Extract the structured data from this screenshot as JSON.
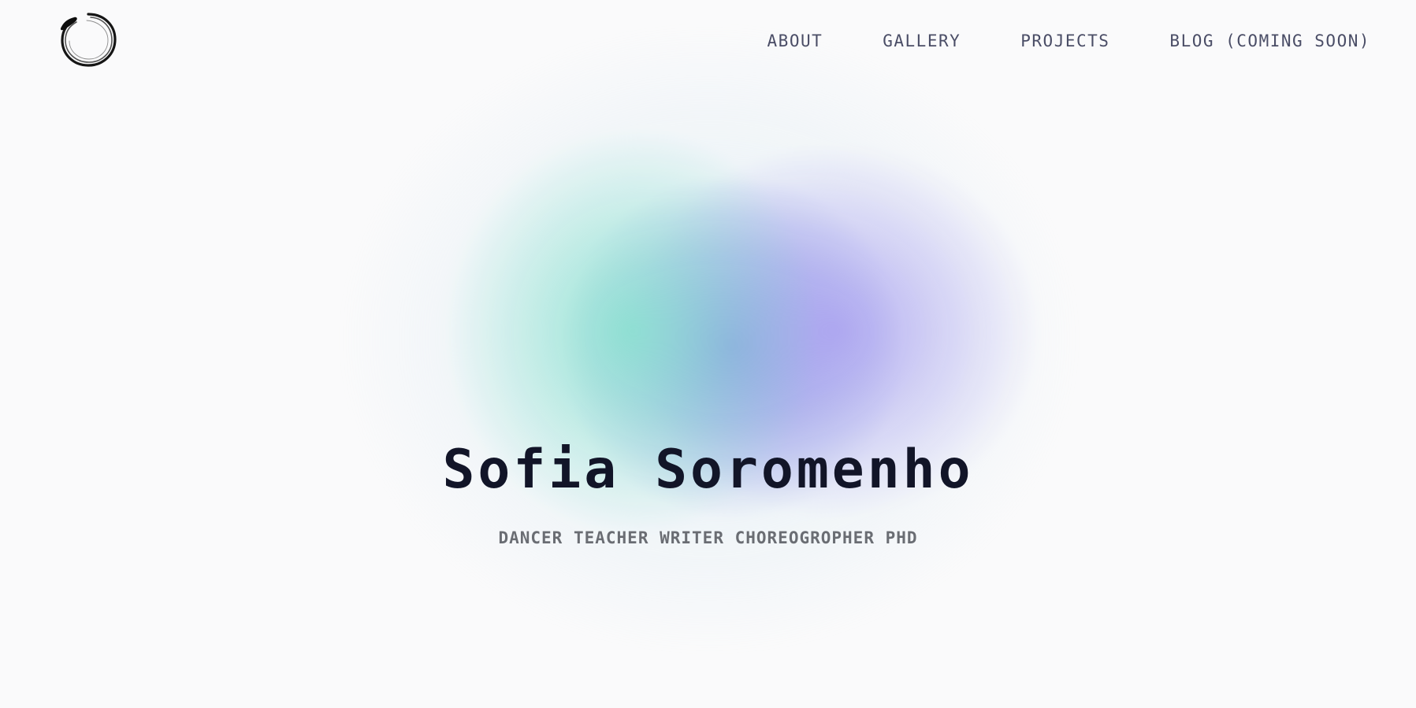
{
  "logo": {
    "icon": "enso-circle-icon"
  },
  "nav": {
    "items": [
      {
        "label": "ABOUT"
      },
      {
        "label": "GALLERY"
      },
      {
        "label": "PROJECTS"
      },
      {
        "label": "BLOG (COMING SOON)"
      }
    ]
  },
  "hero": {
    "title": "Sofia Soromenho",
    "subtitle": "DANCER TEACHER WRITER CHOREOGROPHER PHD"
  },
  "colors": {
    "background": "#fafafb",
    "blob_teal": "#87e2ce",
    "blob_blue": "#5f78d7",
    "blob_purple": "#aaa0f0",
    "title": "#121528",
    "subtitle": "#6a6d73",
    "nav": "#4a4d66"
  }
}
